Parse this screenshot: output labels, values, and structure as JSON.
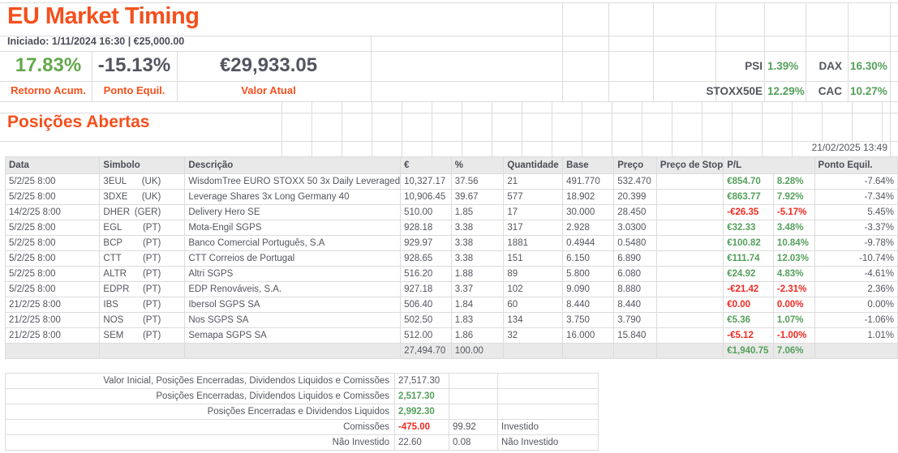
{
  "colors": {
    "accent_orange": "#f4501d",
    "positive_green": "#55a05b",
    "negative_red": "#ee2a21",
    "text_dark": "#54565e"
  },
  "header": {
    "title": "EU Market Timing",
    "started": "Iniciado: 1/11/2024 16:30 | €25,000.00",
    "stats": [
      {
        "value": "17.83%",
        "label": "Retorno Acum.",
        "tone": "pos"
      },
      {
        "value": "-15.13%",
        "label": "Ponto Equil.",
        "tone": "neutral"
      },
      {
        "value": "€29,933.05",
        "label": "Valor Atual",
        "tone": "neutral"
      }
    ],
    "indices": [
      {
        "label": "PSI",
        "value": "1.39%"
      },
      {
        "label": "DAX",
        "value": "16.30%"
      },
      {
        "label": "STOXX50E",
        "value": "12.29%"
      },
      {
        "label": "CAC",
        "value": "10.27%"
      }
    ]
  },
  "positions": {
    "section_title": "Posições Abertas",
    "timestamp": "21/02/2025 13:49",
    "columns": [
      "Data",
      "Simbolo",
      "Descrição",
      "€",
      "%",
      "Quantidade",
      "Base",
      "Preço",
      "Preço de Stop",
      "P/L",
      "Ponto Equil."
    ],
    "rows": [
      {
        "date": "5/2/25 8:00",
        "symbol": "3EUL",
        "country": "(UK)",
        "desc": "WisdomTree EURO STOXX 50 3x Daily Leveraged",
        "eur": "10,327.17",
        "pct": "37.56",
        "qty": "21",
        "base": "491.770",
        "price": "532.470",
        "stop": "",
        "pl_eur": "€854.70",
        "pl_pct": "8.28%",
        "trend": "pos",
        "ponto": "-7.64%"
      },
      {
        "date": "5/2/25 8:00",
        "symbol": "3DXE",
        "country": "(UK)",
        "desc": "Leverage Shares 3x Long Germany 40",
        "eur": "10,906.45",
        "pct": "39.67",
        "qty": "577",
        "base": "18.902",
        "price": "20.399",
        "stop": "",
        "pl_eur": "€863.77",
        "pl_pct": "7.92%",
        "trend": "pos",
        "ponto": "-7.34%"
      },
      {
        "date": "14/2/25 8:00",
        "symbol": "DHER",
        "country": "(GER)",
        "desc": "Delivery Hero SE",
        "eur": "510.00",
        "pct": "1.85",
        "qty": "17",
        "base": "30.000",
        "price": "28.450",
        "stop": "",
        "pl_eur": "-€26.35",
        "pl_pct": "-5.17%",
        "trend": "neg",
        "ponto": "5.45%"
      },
      {
        "date": "5/2/25 8:00",
        "symbol": "EGL",
        "country": "(PT)",
        "desc": "Mota-Engil SGPS",
        "eur": "928.18",
        "pct": "3.38",
        "qty": "317",
        "base": "2.928",
        "price": "3.0300",
        "stop": "",
        "pl_eur": "€32.33",
        "pl_pct": "3.48%",
        "trend": "pos",
        "ponto": "-3.37%"
      },
      {
        "date": "5/2/25 8:00",
        "symbol": "BCP",
        "country": "(PT)",
        "desc": "Banco Comercial Português, S.A",
        "eur": "929.97",
        "pct": "3.38",
        "qty": "1881",
        "base": "0.4944",
        "price": "0.5480",
        "stop": "",
        "pl_eur": "€100.82",
        "pl_pct": "10.84%",
        "trend": "pos",
        "ponto": "-9.78%"
      },
      {
        "date": "5/2/25 8:00",
        "symbol": "CTT",
        "country": "(PT)",
        "desc": "CTT Correios de Portugal",
        "eur": "928.65",
        "pct": "3.38",
        "qty": "151",
        "base": "6.150",
        "price": "6.890",
        "stop": "",
        "pl_eur": "€111.74",
        "pl_pct": "12.03%",
        "trend": "pos",
        "ponto": "-10.74%"
      },
      {
        "date": "5/2/25 8:00",
        "symbol": "ALTR",
        "country": "(PT)",
        "desc": "Altri SGPS",
        "eur": "516.20",
        "pct": "1.88",
        "qty": "89",
        "base": "5.800",
        "price": "6.080",
        "stop": "",
        "pl_eur": "€24.92",
        "pl_pct": "4.83%",
        "trend": "pos",
        "ponto": "-4.61%"
      },
      {
        "date": "5/2/25 8:00",
        "symbol": "EDPR",
        "country": "(PT)",
        "desc": "EDP Renováveis, S.A.",
        "eur": "927.18",
        "pct": "3.37",
        "qty": "102",
        "base": "9.090",
        "price": "8.880",
        "stop": "",
        "pl_eur": "-€21.42",
        "pl_pct": "-2.31%",
        "trend": "neg",
        "ponto": "2.36%"
      },
      {
        "date": "21/2/25 8:00",
        "symbol": "IBS",
        "country": "(PT)",
        "desc": "Ibersol SGPS SA",
        "eur": "506.40",
        "pct": "1.84",
        "qty": "60",
        "base": "8.440",
        "price": "8.440",
        "stop": "",
        "pl_eur": "€0.00",
        "pl_pct": "0.00%",
        "trend": "neg",
        "ponto": "0.00%"
      },
      {
        "date": "21/2/25 8:00",
        "symbol": "NOS",
        "country": "(PT)",
        "desc": "Nos SGPS SA",
        "eur": "502.50",
        "pct": "1.83",
        "qty": "134",
        "base": "3.750",
        "price": "3.790",
        "stop": "",
        "pl_eur": "€5.36",
        "pl_pct": "1.07%",
        "trend": "pos",
        "ponto": "-1.06%"
      },
      {
        "date": "21/2/25 8:00",
        "symbol": "SEM",
        "country": "(PT)",
        "desc": "Semapa SGPS SA",
        "eur": "512.00",
        "pct": "1.86",
        "qty": "32",
        "base": "16.000",
        "price": "15.840",
        "stop": "",
        "pl_eur": "-€5.12",
        "pl_pct": "-1.00%",
        "trend": "neg",
        "ponto": "1.01%"
      }
    ],
    "totals": {
      "eur": "27,494.70",
      "pct": "100.00",
      "pl_eur": "€1,940.75",
      "pl_pct": "7.06%"
    }
  },
  "summary": {
    "rows": [
      {
        "label": "Valor Inicial, Posições Encerradas, Dividendos Liquidos e Comissões",
        "v1": "27,517.30",
        "v2": "",
        "v3": ""
      },
      {
        "label": "Posições Encerradas, Dividendos Liquidos e Comissões",
        "v1": "2,517.30",
        "v1_cls": "pos",
        "v2": "",
        "v3": ""
      },
      {
        "label": "Posições Encerradas e Dividendos Liquidos",
        "v1": "2,992.30",
        "v1_cls": "pos",
        "v2": "",
        "v3": ""
      },
      {
        "label": "Comissões",
        "v1": "-475.00",
        "v1_cls": "neg",
        "v2": "99.92",
        "v3": "Investido"
      },
      {
        "label": "Não Investido",
        "v1": "22.60",
        "v2": "0.08",
        "v3": "Não Investido"
      }
    ]
  }
}
